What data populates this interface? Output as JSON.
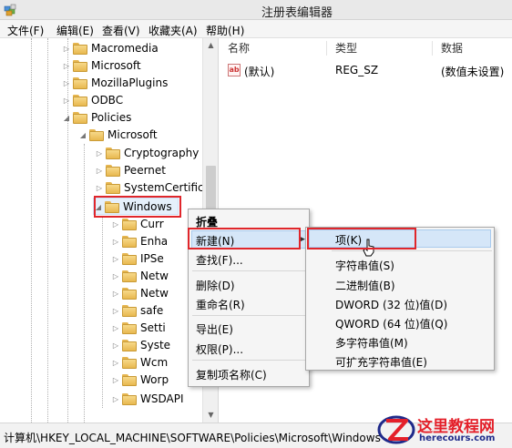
{
  "window": {
    "title": "注册表编辑器"
  },
  "menu": [
    "文件(F)",
    "编辑(E)",
    "查看(V)",
    "收藏夹(A)",
    "帮助(H)"
  ],
  "tree": {
    "items": [
      "Macromedia",
      "Microsoft",
      "MozillaPlugins",
      "ODBC",
      "Policies",
      "Microsoft",
      "Cryptography",
      "Peernet",
      "SystemCertifica",
      "Windows",
      "Curr",
      "Enha",
      "IPSe",
      "Netw",
      "Netw",
      "safe",
      "Setti",
      "Syste",
      "Wcm",
      "Worp",
      "WSDAPI"
    ]
  },
  "list": {
    "headers": {
      "name": "名称",
      "type": "类型",
      "data": "数据"
    },
    "rows": [
      {
        "icon": "ab",
        "name": "(默认)",
        "type": "REG_SZ",
        "data": "(数值未设置)"
      }
    ]
  },
  "context_menu": {
    "collapse": "折叠",
    "new": "新建(N)",
    "find": "查找(F)...",
    "delete": "删除(D)",
    "rename": "重命名(R)",
    "export": "导出(E)",
    "permissions": "权限(P)...",
    "copy_key_name": "复制项名称(C)"
  },
  "submenu": {
    "key": "项(K)",
    "string": "字符串值(S)",
    "binary": "二进制值(B)",
    "dword": "DWORD (32 位)值(D)",
    "qword": "QWORD (64 位)值(Q)",
    "multi_string": "多字符串值(M)",
    "expandable_string": "可扩充字符串值(E)"
  },
  "status": {
    "path": "计算机\\HKEY_LOCAL_MACHINE\\SOFTWARE\\Policies\\Microsoft\\Windows"
  },
  "watermark": {
    "name": "这里教程网",
    "url": "herecours.com"
  },
  "colors": {
    "highlight_red": "#e0262b",
    "menu_hover": "#d5e6f8",
    "folder": "#e8b84f"
  }
}
